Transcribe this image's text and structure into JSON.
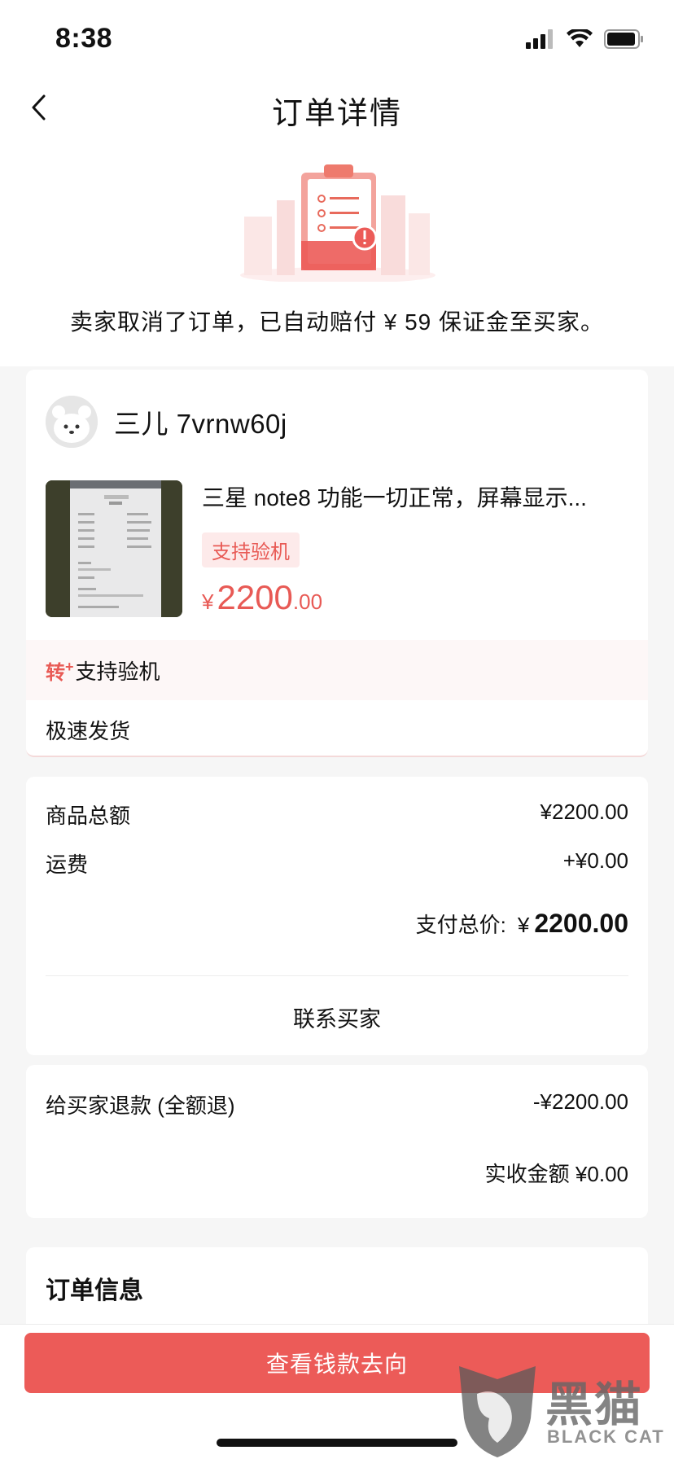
{
  "status_bar": {
    "time": "8:38"
  },
  "nav": {
    "title": "订单详情"
  },
  "notice": {
    "text": "卖家取消了订单，已自动赔付 ¥ 59 保证金至买家。"
  },
  "seller": {
    "name": "三儿 7vrnw60j"
  },
  "product": {
    "title": "三星 note8 功能一切正常，屏幕显示...",
    "tag": "支持验机",
    "price_symbol": "¥",
    "price_int": "2200",
    "price_dec": ".00"
  },
  "features": {
    "inspection_icon": "转",
    "inspection_icon_sup": "+",
    "inspection_label": "支持验机",
    "fast_shipping": "极速发货"
  },
  "summary": {
    "goods_total_label": "商品总额",
    "goods_total_value": "¥2200.00",
    "shipping_label": "运费",
    "shipping_value": "+¥0.00",
    "paid_total_label": "支付总价:",
    "paid_total_symbol": "¥",
    "paid_total_value": "2200.00",
    "contact_buyer": "联系买家"
  },
  "refund": {
    "label": "给买家退款 (全额退)",
    "value": "-¥2200.00",
    "received_label": "实收金额",
    "received_value": "¥0.00"
  },
  "order_info": {
    "title": "订单信息"
  },
  "bottom": {
    "button_label": "查看钱款去向"
  },
  "watermark": {
    "big": "黑猫",
    "small": "BLACK CAT"
  },
  "colors": {
    "accent": "#ec5b58",
    "price": "#e85a55",
    "background": "#f6f6f6"
  }
}
